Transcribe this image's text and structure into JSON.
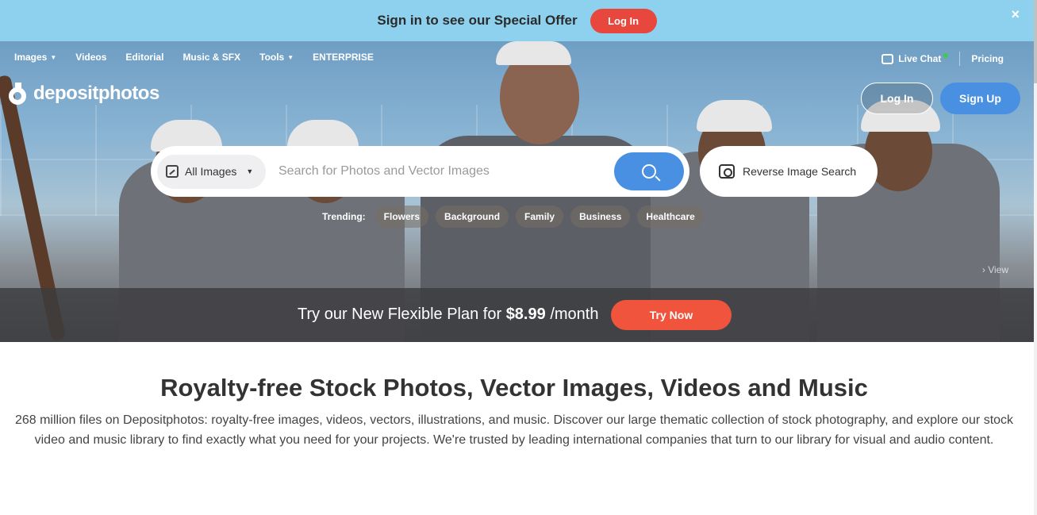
{
  "promo": {
    "text": "Sign in to see our Special Offer",
    "login_label": "Log In",
    "close_symbol": "×"
  },
  "nav": {
    "items": [
      {
        "label": "Images",
        "has_caret": true
      },
      {
        "label": "Videos",
        "has_caret": false
      },
      {
        "label": "Editorial",
        "has_caret": false
      },
      {
        "label": "Music & SFX",
        "has_caret": false
      },
      {
        "label": "Tools",
        "has_caret": true
      },
      {
        "label": "ENTERPRISE",
        "has_caret": false
      }
    ],
    "live_chat": "Live Chat",
    "pricing": "Pricing"
  },
  "brand": {
    "logo_text": "depositphotos"
  },
  "auth": {
    "login_label": "Log In",
    "signup_label": "Sign Up"
  },
  "search": {
    "type_label": "All Images",
    "placeholder": "Search for Photos and Vector Images",
    "reverse_label": "Reverse Image Search"
  },
  "trending": {
    "label": "Trending:",
    "chips": [
      "Flowers",
      "Background",
      "Family",
      "Business",
      "Healthcare"
    ]
  },
  "hero": {
    "view_label": "View"
  },
  "plan": {
    "text_before": "Try our New Flexible Plan for",
    "price": "$8.99",
    "text_after": "/month",
    "cta": "Try Now"
  },
  "content": {
    "headline": "Royalty-free Stock Photos, Vector Images, Videos and Music",
    "description": "268 million files on Depositphotos: royalty-free images, videos, vectors, illustrations, and music. Discover our large thematic collection of stock photography, and explore our stock video and music library to find exactly what you need for your projects. We're trusted by leading international companies that turn to our library for visual and audio content."
  },
  "colors": {
    "promo_bg": "#8ed1ef",
    "accent_red": "#e8473d",
    "accent_blue": "#4a90e2",
    "cta_orange": "#f0543c",
    "online_green": "#3ecb4a"
  },
  "icons": [
    "close-icon",
    "caret-down-icon",
    "chat-icon",
    "logo-icon",
    "image-type-icon",
    "search-icon",
    "reverse-image-search-icon",
    "chevron-right-icon"
  ]
}
